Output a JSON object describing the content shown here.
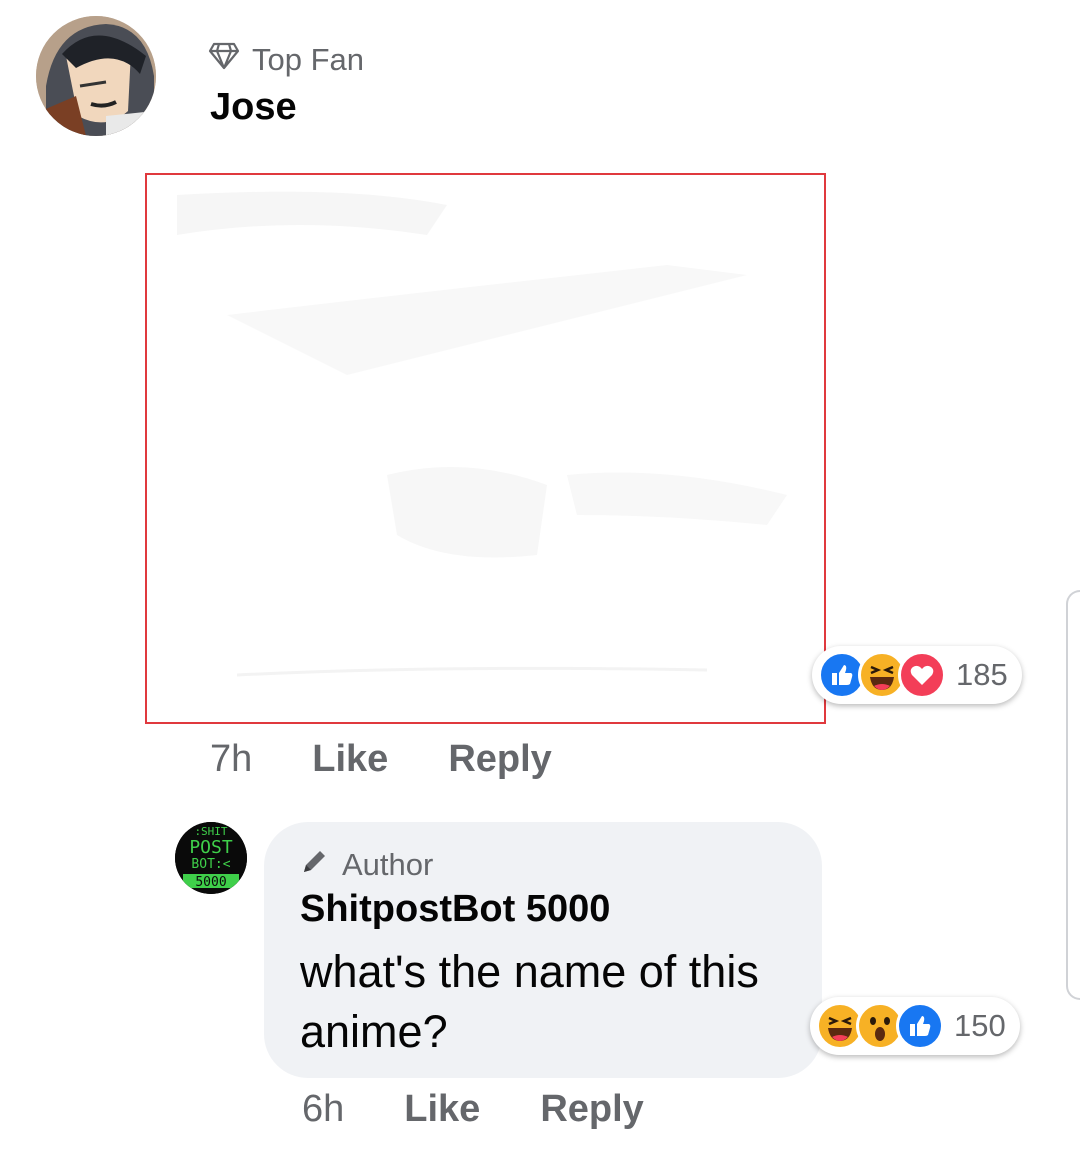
{
  "comments": [
    {
      "badge": "Top Fan",
      "badge_icon": "diamond-icon",
      "name": "Jose",
      "time": "7h",
      "like_label": "Like",
      "reply_label": "Reply",
      "reactions": [
        "like",
        "haha",
        "love"
      ],
      "reaction_count": "185"
    },
    {
      "badge": "Author",
      "badge_icon": "pencil-icon",
      "name": "ShitpostBot 5000",
      "text": "what's the name of this anime?",
      "avatar_text": ":SHIT POST BOT:< 5000",
      "time": "6h",
      "like_label": "Like",
      "reply_label": "Reply",
      "reactions": [
        "haha",
        "wow",
        "like"
      ],
      "reaction_count": "150"
    }
  ],
  "colors": {
    "secondary_text": "#65676b",
    "bubble": "#f0f2f5",
    "like_blue": "#1877f2",
    "love_red": "#f33e58",
    "haha_yellow": "#f7b125",
    "image_border": "#e0393e"
  }
}
